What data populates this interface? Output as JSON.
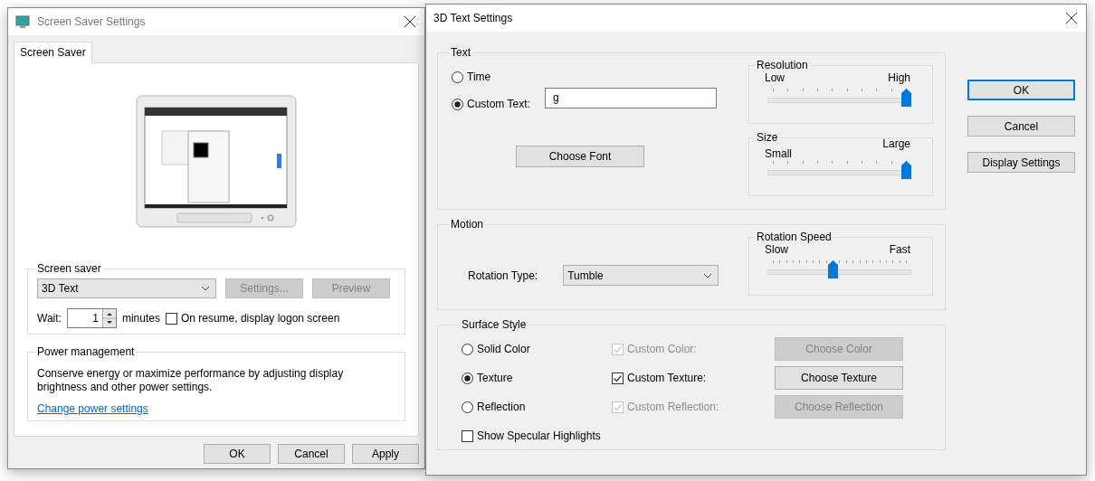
{
  "screen_saver_settings": {
    "title": "Screen Saver Settings",
    "tabs": [
      {
        "label": "Screen Saver",
        "selected": true
      }
    ],
    "screen_saver": {
      "group_label": "Screen saver",
      "selected": "3D Text",
      "buttons": [
        {
          "label": "Settings...",
          "disabled": true
        },
        {
          "label": "Preview",
          "disabled": true
        }
      ],
      "wait_label": "Wait:",
      "wait_value": "1",
      "minutes_label": "minutes",
      "logon": {
        "label": "On resume, display logon screen",
        "checked": false
      }
    },
    "power_management": {
      "group_label": "Power management",
      "description": "Conserve energy or maximize performance by adjusting display brightness and other power settings.",
      "link": "Change power settings"
    },
    "buttons": [
      {
        "label": "OK",
        "disabled": false
      },
      {
        "label": "Cancel",
        "disabled": false
      },
      {
        "label": "Apply",
        "disabled": false
      }
    ]
  },
  "text_settings_dialog": {
    "title": "3D Text Settings",
    "text": {
      "group_label": "Text",
      "options": [
        {
          "label": "Time",
          "selected": false
        },
        {
          "label": "Custom Text:",
          "selected": true
        }
      ],
      "custom_text": "g",
      "choose_font": "Choose Font",
      "resolution": {
        "label": "Resolution",
        "min_label": "Low",
        "max_label": "High",
        "level": 1
      },
      "size": {
        "label": "Size",
        "min_label": "Small",
        "max_label": "Large",
        "level": 1
      }
    },
    "motion": {
      "group_label": "Motion",
      "rotation_type_label": "Rotation Type:",
      "rotation_type": "Tumble",
      "rotation_speed": {
        "label": "Rotation Speed",
        "min_label": "Slow",
        "max_label": "Fast",
        "level": 0.45
      }
    },
    "surface_style": {
      "group_label": "Surface Style",
      "styles": [
        {
          "label": "Solid Color",
          "selected": false,
          "custom": {
            "label": "Custom Color:",
            "checked": true,
            "disabled": true
          },
          "button": {
            "label": "Choose Color",
            "disabled": true
          }
        },
        {
          "label": "Texture",
          "selected": true,
          "custom": {
            "label": "Custom Texture:",
            "checked": true,
            "disabled": false
          },
          "button": {
            "label": "Choose Texture",
            "disabled": false
          }
        },
        {
          "label": "Reflection",
          "selected": false,
          "custom": {
            "label": "Custom Reflection:",
            "checked": true,
            "disabled": true
          },
          "button": {
            "label": "Choose Reflection",
            "disabled": true
          }
        }
      ],
      "specular": {
        "label": "Show Specular Highlights",
        "checked": false
      }
    },
    "buttons": [
      {
        "label": "OK",
        "default": true
      },
      {
        "label": "Cancel",
        "default": false
      },
      {
        "label": "Display Settings",
        "default": false
      }
    ]
  }
}
